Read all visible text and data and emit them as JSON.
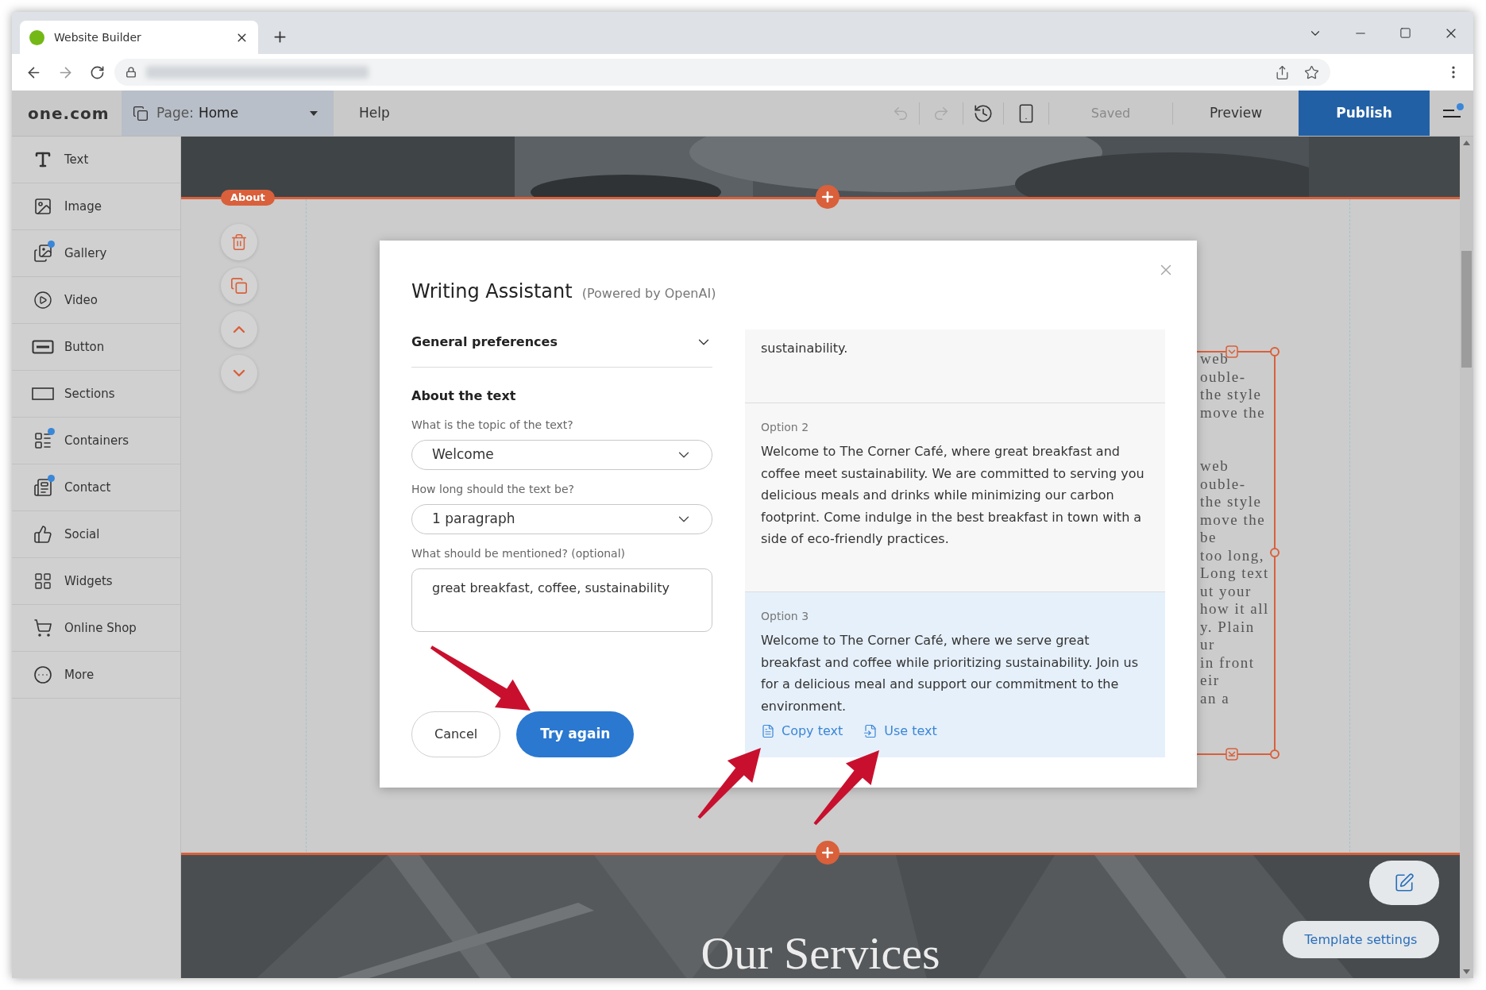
{
  "browser": {
    "tab": {
      "title": "Website Builder"
    }
  },
  "toolbar": {
    "logo": "one.com",
    "page": {
      "label": "Page:",
      "value": "Home"
    },
    "help": "Help",
    "undo": {
      "disabled": true
    },
    "redo": {
      "disabled": true
    },
    "status": "Saved",
    "preview": "Preview",
    "publish": "Publish",
    "menu_notification": true
  },
  "sidebar": {
    "items": [
      {
        "label": "Text",
        "dot": false
      },
      {
        "label": "Image",
        "dot": false
      },
      {
        "label": "Gallery",
        "dot": true
      },
      {
        "label": "Video",
        "dot": false
      },
      {
        "label": "Button",
        "dot": false
      },
      {
        "label": "Sections",
        "dot": false
      },
      {
        "label": "Containers",
        "dot": true
      },
      {
        "label": "Contact",
        "dot": true
      },
      {
        "label": "Social",
        "dot": false
      },
      {
        "label": "Widgets",
        "dot": false
      },
      {
        "label": "Online Shop",
        "dot": false
      },
      {
        "label": "More",
        "dot": false
      }
    ]
  },
  "canvas": {
    "section_tag": "About",
    "text_paragraphs": [
      {
        "lines": [
          "web",
          "ouble-",
          "the style",
          "move the"
        ]
      },
      {
        "lines": [
          "web",
          "ouble-",
          "the style",
          "move the",
          "be",
          "too long,",
          "Long text",
          "ut your",
          "how it all",
          "y. Plain",
          "ur",
          "in front",
          "eir",
          "an a"
        ]
      }
    ],
    "section_heading": "Our Services",
    "template_settings": "Template settings"
  },
  "dialog": {
    "title": "Writing Assistant",
    "subtitle": "(Powered by OpenAI)",
    "general_preferences": {
      "label": "General preferences",
      "expanded": false
    },
    "section_title": "About the text",
    "fields": [
      {
        "kind": "select",
        "label": "What is the topic of the text?",
        "value": "Welcome"
      },
      {
        "kind": "select",
        "label": "How long should the text be?",
        "value": "1 paragraph"
      },
      {
        "kind": "textarea",
        "label": "What should be mentioned? (optional)",
        "value": "great breakfast, coffee, sustainability"
      }
    ],
    "buttons": [
      {
        "kind": "secondary",
        "label": "Cancel"
      },
      {
        "kind": "primary",
        "label": "Try again"
      }
    ],
    "options": [
      {
        "text": "sustainability.",
        "selected": false
      },
      {
        "label": "Option 2",
        "text": "Welcome to The Corner Café, where great breakfast and coffee meet sustainability. We are committed to serving you delicious meals and drinks while minimizing our carbon footprint. Come indulge in the best breakfast in town with a side of eco-friendly practices.",
        "selected": false
      },
      {
        "label": "Option 3",
        "text": "Welcome to The Corner Café, where we serve great breakfast and coffee while prioritizing sustainability. Join us for a delicious meal and support our commitment to the environment.",
        "selected": true,
        "actions": [
          {
            "kind": "copy",
            "label": "Copy text"
          },
          {
            "kind": "use",
            "label": "Use text"
          }
        ]
      }
    ]
  }
}
